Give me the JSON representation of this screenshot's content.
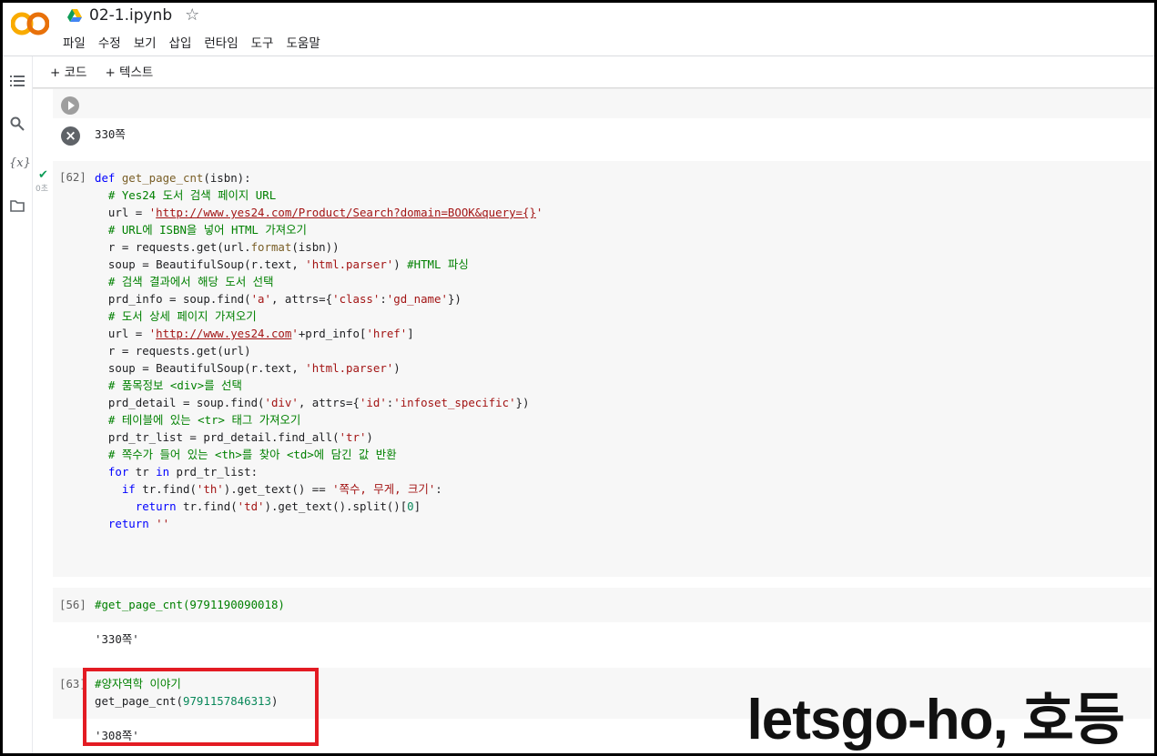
{
  "app": {
    "logo_text": "CO",
    "file_name": "02-1.ipynb",
    "star": "☆"
  },
  "menu": [
    "파일",
    "수정",
    "보기",
    "삽입",
    "런타임",
    "도구",
    "도움말"
  ],
  "toolbar": {
    "add_code": "+ 코드",
    "add_text": "+ 텍스트"
  },
  "sidebar": {
    "icons": [
      "toc-icon",
      "search-icon",
      "variables-icon",
      "folder-icon"
    ],
    "variables_glyph": "{x}"
  },
  "cells": {
    "prev_output": "330쪽",
    "cell62": {
      "count": "[62]",
      "status_time": "0초",
      "lines": [
        [
          [
            "kw",
            "def "
          ],
          [
            "fn",
            "get_page_cnt"
          ],
          [
            "",
            "(isbn):"
          ]
        ],
        [
          [
            "",
            "  "
          ],
          [
            "cm",
            "# Yes24 도서 검색 페이지 URL"
          ]
        ],
        [
          [
            "",
            "  url = "
          ],
          [
            "str",
            "'"
          ],
          [
            "url",
            "http://www.yes24.com/Product/Search?domain=BOOK&query={}"
          ],
          [
            "str",
            "'"
          ]
        ],
        [
          [
            "",
            "  "
          ],
          [
            "cm",
            "# URL에 ISBN을 넣어 HTML 가져오기"
          ]
        ],
        [
          [
            "",
            "  r = requests.get(url."
          ],
          [
            "fn",
            "format"
          ],
          [
            "",
            "(isbn))"
          ]
        ],
        [
          [
            "",
            "  soup = BeautifulSoup(r.text, "
          ],
          [
            "str",
            "'html.parser'"
          ],
          [
            "",
            ") "
          ],
          [
            "cm",
            "#HTML 파싱"
          ]
        ],
        [
          [
            "",
            "  "
          ],
          [
            "cm",
            "# 검색 결과에서 해당 도서 선택"
          ]
        ],
        [
          [
            "",
            "  prd_info = soup.find("
          ],
          [
            "str",
            "'a'"
          ],
          [
            "",
            ", attrs={"
          ],
          [
            "str",
            "'class'"
          ],
          [
            "",
            ":"
          ],
          [
            "str",
            "'gd_name'"
          ],
          [
            "",
            "})"
          ]
        ],
        [
          [
            "",
            "  "
          ],
          [
            "cm",
            "# 도서 상세 페이지 가져오기"
          ]
        ],
        [
          [
            "",
            "  url = "
          ],
          [
            "str",
            "'"
          ],
          [
            "url",
            "http://www.yes24.com"
          ],
          [
            "str",
            "'"
          ],
          [
            "",
            "+prd_info["
          ],
          [
            "str",
            "'href'"
          ],
          [
            "",
            "]"
          ]
        ],
        [
          [
            "",
            "  r = requests.get(url)"
          ]
        ],
        [
          [
            "",
            "  soup = BeautifulSoup(r.text, "
          ],
          [
            "str",
            "'html.parser'"
          ],
          [
            "",
            ")"
          ]
        ],
        [
          [
            "",
            "  "
          ],
          [
            "cm",
            "# 품목정보 <div>를 선택"
          ]
        ],
        [
          [
            "",
            "  prd_detail = soup.find("
          ],
          [
            "str",
            "'div'"
          ],
          [
            "",
            ", attrs={"
          ],
          [
            "str",
            "'id'"
          ],
          [
            "",
            ":"
          ],
          [
            "str",
            "'infoset_specific'"
          ],
          [
            "",
            "})"
          ]
        ],
        [
          [
            "",
            "  "
          ],
          [
            "cm",
            "# 테이블에 있는 <tr> 태그 가져오기"
          ]
        ],
        [
          [
            "",
            "  prd_tr_list = prd_detail.find_all("
          ],
          [
            "str",
            "'tr'"
          ],
          [
            "",
            ")"
          ]
        ],
        [
          [
            "",
            "  "
          ],
          [
            "cm",
            "# 쪽수가 들어 있는 <th>를 찾아 <td>에 담긴 값 반환"
          ]
        ],
        [
          [
            "",
            "  "
          ],
          [
            "kw",
            "for "
          ],
          [
            "",
            "tr "
          ],
          [
            "kw",
            "in "
          ],
          [
            "",
            "prd_tr_list:"
          ]
        ],
        [
          [
            "",
            "    "
          ],
          [
            "kw",
            "if "
          ],
          [
            "",
            "tr.find("
          ],
          [
            "str",
            "'th'"
          ],
          [
            "",
            ").get_text() == "
          ],
          [
            "str",
            "'쪽수, 무게, 크기'"
          ],
          [
            "",
            ":"
          ]
        ],
        [
          [
            "",
            "      "
          ],
          [
            "kw",
            "return "
          ],
          [
            "",
            "tr.find("
          ],
          [
            "str",
            "'td'"
          ],
          [
            "",
            ").get_text().split()["
          ],
          [
            "num",
            "0"
          ],
          [
            "",
            "]"
          ]
        ],
        [
          [
            "",
            "  "
          ],
          [
            "kw",
            "return "
          ],
          [
            "str",
            "''"
          ]
        ]
      ]
    },
    "cell56": {
      "count": "[56]",
      "code": "#get_page_cnt(9791190090018)",
      "output": "'330쪽'"
    },
    "cell63": {
      "count": "[63]",
      "comment": "#양자역학 이야기",
      "call_prefix": "get_page_cnt(",
      "call_arg": "9791157846313",
      "call_suffix": ")",
      "output": "'308쪽'"
    }
  },
  "watermark": "letsgo-ho, 호등",
  "colors": {
    "keyword": "#0000ff",
    "comment": "#008000",
    "string": "#a31515",
    "function": "#795e26",
    "number": "#09885a",
    "highlight": "#e31b23",
    "success": "#0f9d58"
  }
}
